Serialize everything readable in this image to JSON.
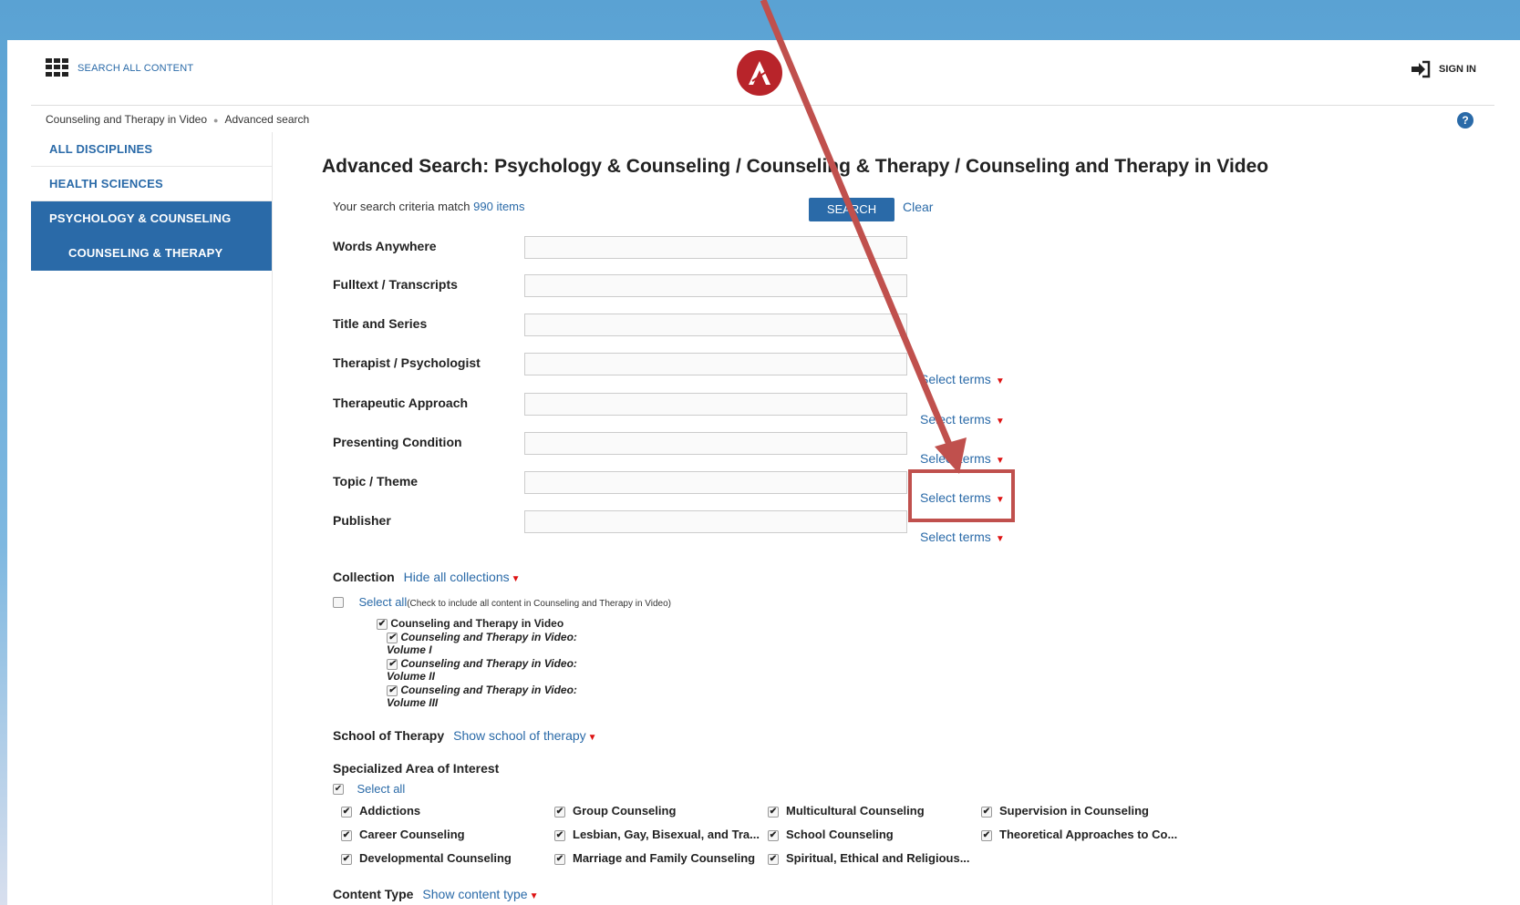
{
  "header": {
    "search_all_label": "SEARCH ALL CONTENT",
    "sign_in_label": "SIGN IN"
  },
  "breadcrumb": {
    "items": [
      "Counseling and Therapy in Video",
      "Advanced search"
    ]
  },
  "sidebar": {
    "items": [
      {
        "label": "ALL DISCIPLINES"
      },
      {
        "label": "HEALTH SCIENCES"
      },
      {
        "label": "PSYCHOLOGY & COUNSELING"
      },
      {
        "label": "COUNSELING & THERAPY"
      }
    ]
  },
  "main": {
    "title": "Advanced Search: Psychology & Counseling / Counseling & Therapy / Counseling and Therapy in Video",
    "match_prefix": "Your search criteria match ",
    "match_count": "990 items",
    "search_button": "SEARCH",
    "clear_link": "Clear",
    "fields": [
      {
        "label": "Words Anywhere",
        "value": "",
        "select_terms": ""
      },
      {
        "label": "Fulltext / Transcripts",
        "value": "",
        "select_terms": ""
      },
      {
        "label": "Title and Series",
        "value": "",
        "select_terms": ""
      },
      {
        "label": "Therapist / Psychologist",
        "value": "",
        "select_terms": "Select terms"
      },
      {
        "label": "Therapeutic Approach",
        "value": "",
        "select_terms": "Select terms"
      },
      {
        "label": "Presenting Condition",
        "value": "",
        "select_terms": "Select terms"
      },
      {
        "label": "Topic / Theme",
        "value": "",
        "select_terms": "Select terms"
      },
      {
        "label": "Publisher",
        "value": "",
        "select_terms": "Select terms"
      }
    ],
    "collection": {
      "label": "Collection",
      "toggle_link": "Hide all collections",
      "select_all": "Select all",
      "select_all_note": "(Check to include all content in Counseling and Therapy in Video)",
      "items": [
        "Counseling and Therapy in Video",
        "Counseling and Therapy in Video: Volume I",
        "Counseling and Therapy in Video: Volume II",
        "Counseling and Therapy in Video: Volume III"
      ]
    },
    "school": {
      "label": "School of Therapy",
      "toggle_link": "Show school of therapy"
    },
    "specialized": {
      "label": "Specialized Area of Interest",
      "select_all": "Select all",
      "items": [
        "Addictions",
        "Career Counseling",
        "Developmental Counseling",
        "Group Counseling",
        "Lesbian, Gay, Bisexual, and Tra...",
        "Marriage and Family Counseling",
        "Multicultural Counseling",
        "School Counseling",
        "Spiritual, Ethical and Religious...",
        "Supervision in Counseling",
        "Theoretical Approaches to Co..."
      ]
    },
    "content_type": {
      "label": "Content Type",
      "toggle_link": "Show content type"
    }
  },
  "colors": {
    "link": "#2a6aa8",
    "annotation": "#c0504d",
    "logo": "#b8242a"
  }
}
